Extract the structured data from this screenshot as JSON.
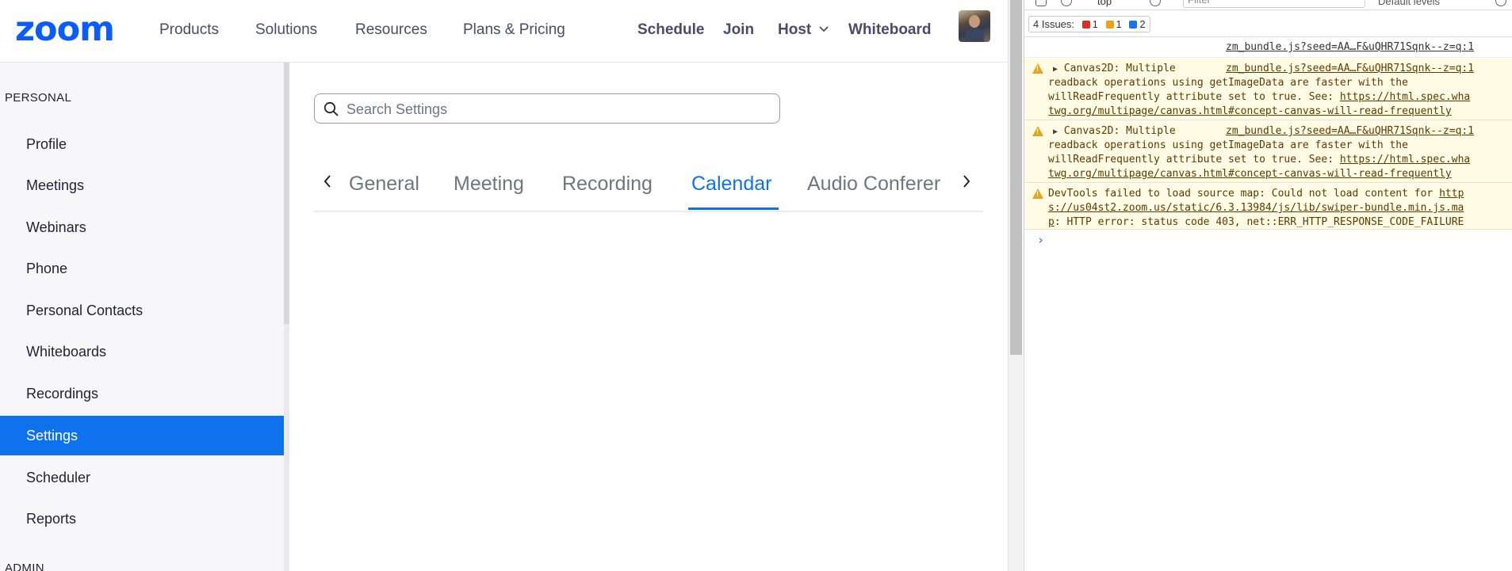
{
  "brand": {
    "logo": "zoom",
    "accent": "#0b5cff",
    "active_blue": "#0e72ed"
  },
  "topnav": {
    "items": [
      "Products",
      "Solutions",
      "Resources",
      "Plans & Pricing"
    ],
    "actions": [
      "Schedule",
      "Join",
      "Host",
      "Whiteboard"
    ]
  },
  "sidebar": {
    "section_personal": "PERSONAL",
    "items": [
      "Profile",
      "Meetings",
      "Webinars",
      "Phone",
      "Personal Contacts",
      "Whiteboards",
      "Recordings",
      "Settings",
      "Scheduler",
      "Reports"
    ],
    "active": "Settings",
    "section_admin": "ADMIN"
  },
  "search": {
    "placeholder": "Search Settings"
  },
  "tabs": {
    "items": [
      "General",
      "Meeting",
      "Recording",
      "Calendar",
      "Audio Conferer"
    ],
    "active": "Calendar"
  },
  "devtools": {
    "context": "top",
    "filter_placeholder": "Filter",
    "levels": "Default levels",
    "issues_label": "4 Issues:",
    "issues_err": "1",
    "issues_warn": "1",
    "issues_info": "2",
    "source_link": "zm_bundle.js?seed=AA…F&uQHR71Sqnk--z=q:1",
    "msg1_l1": "Canvas2D: Multiple",
    "msg1_l2": "readback operations using getImageData are faster with the",
    "msg1_l3": "willReadFrequently attribute set to true. See: ",
    "msg1_url1": "https://html.spec.wha",
    "msg1_url2": "twg.org/multipage/canvas.html#concept-canvas-will-read-frequently",
    "msg3_l1": "DevTools failed to load source map: Could not load content for ",
    "msg3_url1": "http",
    "msg3_url2": "s://us04st2.zoom.us/static/6.3.13984/js/lib/swiper-bundle.min.js.ma",
    "msg3_url3": "p",
    "msg3_tail": ": HTTP error: status code 403, net::ERR_HTTP_RESPONSE_CODE_FAILURE",
    "prompt": "›"
  }
}
